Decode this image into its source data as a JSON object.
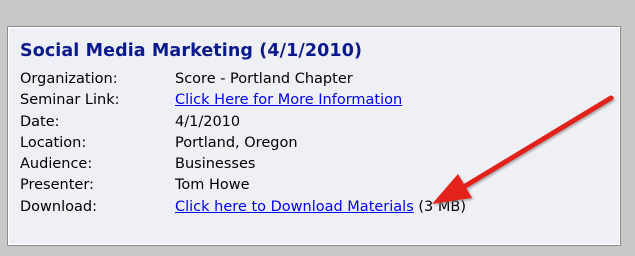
{
  "event": {
    "title": "Social Media Marketing (4/1/2010)",
    "rows": [
      {
        "label": "Organization:",
        "value": "Score - Portland Chapter"
      },
      {
        "label": "Seminar Link:",
        "link": "Click Here for More Information"
      },
      {
        "label": "Date:",
        "value": "4/1/2010"
      },
      {
        "label": "Location:",
        "value": "Portland, Oregon"
      },
      {
        "label": "Audience:",
        "value": "Businesses"
      },
      {
        "label": "Presenter:",
        "value": "Tom Howe"
      },
      {
        "label": "Download:",
        "link": "Click here to Download Materials",
        "suffix": " (3 MB)"
      }
    ]
  },
  "colors": {
    "title": "#0a1a8c",
    "link": "#0000ee",
    "arrow": "#e3231b",
    "card_background": "#eef0f6"
  },
  "annotation": {
    "icon": "red-arrow-icon"
  }
}
